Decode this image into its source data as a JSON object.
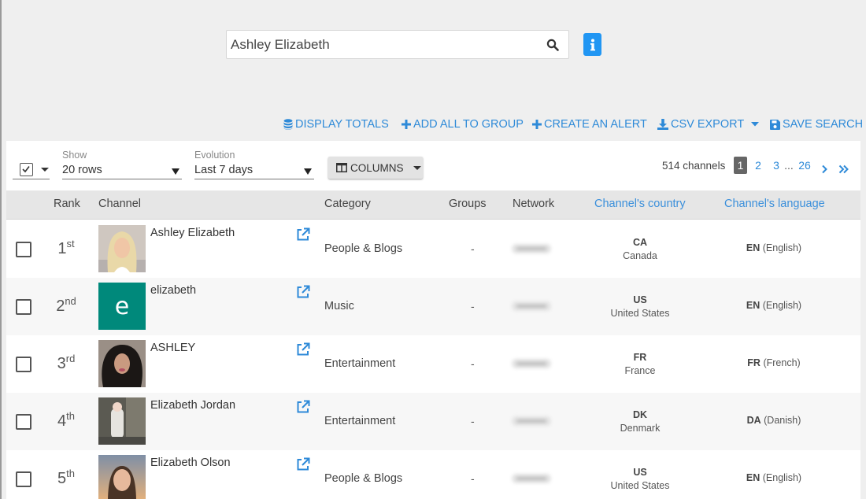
{
  "search": {
    "value": "Ashley Elizabeth"
  },
  "toolbar": {
    "display_totals": "DISPLAY TOTALS",
    "add_all_to_group": "ADD ALL TO GROUP",
    "create_alert": "CREATE AN ALERT",
    "csv_export": "CSV EXPORT",
    "save_search": "SAVE SEARCH"
  },
  "controls": {
    "show_label": "Show",
    "show_value": "20 rows",
    "evolution_label": "Evolution",
    "evolution_value": "Last 7 days",
    "columns_label": "COLUMNS"
  },
  "pagination": {
    "channel_count": "514 channels",
    "pages": [
      "1",
      "2",
      "3",
      "...",
      "26"
    ],
    "active_page": "1"
  },
  "table": {
    "headers": {
      "rank": "Rank",
      "channel": "Channel",
      "category": "Category",
      "groups": "Groups",
      "network": "Network",
      "country": "Channel's country",
      "language": "Channel's language"
    },
    "rows": [
      {
        "rank": "1",
        "rank_suffix": "st",
        "channel": "Ashley Elizabeth",
        "category": "People & Blogs",
        "groups": "-",
        "country_code": "CA",
        "country_name": "Canada",
        "lang_code": "EN",
        "lang_name": "(English)"
      },
      {
        "rank": "2",
        "rank_suffix": "nd",
        "channel": "elizabeth",
        "thumb_letter": "e",
        "category": "Music",
        "groups": "-",
        "country_code": "US",
        "country_name": "United States",
        "lang_code": "EN",
        "lang_name": "(English)"
      },
      {
        "rank": "3",
        "rank_suffix": "rd",
        "channel": "ASHLEY",
        "category": "Entertainment",
        "groups": "-",
        "country_code": "FR",
        "country_name": "France",
        "lang_code": "FR",
        "lang_name": "(French)"
      },
      {
        "rank": "4",
        "rank_suffix": "th",
        "channel": "Elizabeth Jordan",
        "category": "Entertainment",
        "groups": "-",
        "country_code": "DK",
        "country_name": "Denmark",
        "lang_code": "DA",
        "lang_name": "(Danish)"
      },
      {
        "rank": "5",
        "rank_suffix": "th",
        "channel": "Elizabeth Olson",
        "category": "People & Blogs",
        "groups": "-",
        "country_code": "US",
        "country_name": "United States",
        "lang_code": "EN",
        "lang_name": "(English)"
      }
    ]
  },
  "colors": {
    "accent": "#2e8ad8",
    "info_button": "#2196f3",
    "letter_avatar": "#00897b"
  },
  "icons": [
    "search-icon",
    "info-icon",
    "database-icon",
    "plus-icon",
    "download-icon",
    "save-icon",
    "columns-icon",
    "external-link-icon",
    "chevron-right-icon",
    "double-chevron-right-icon"
  ]
}
